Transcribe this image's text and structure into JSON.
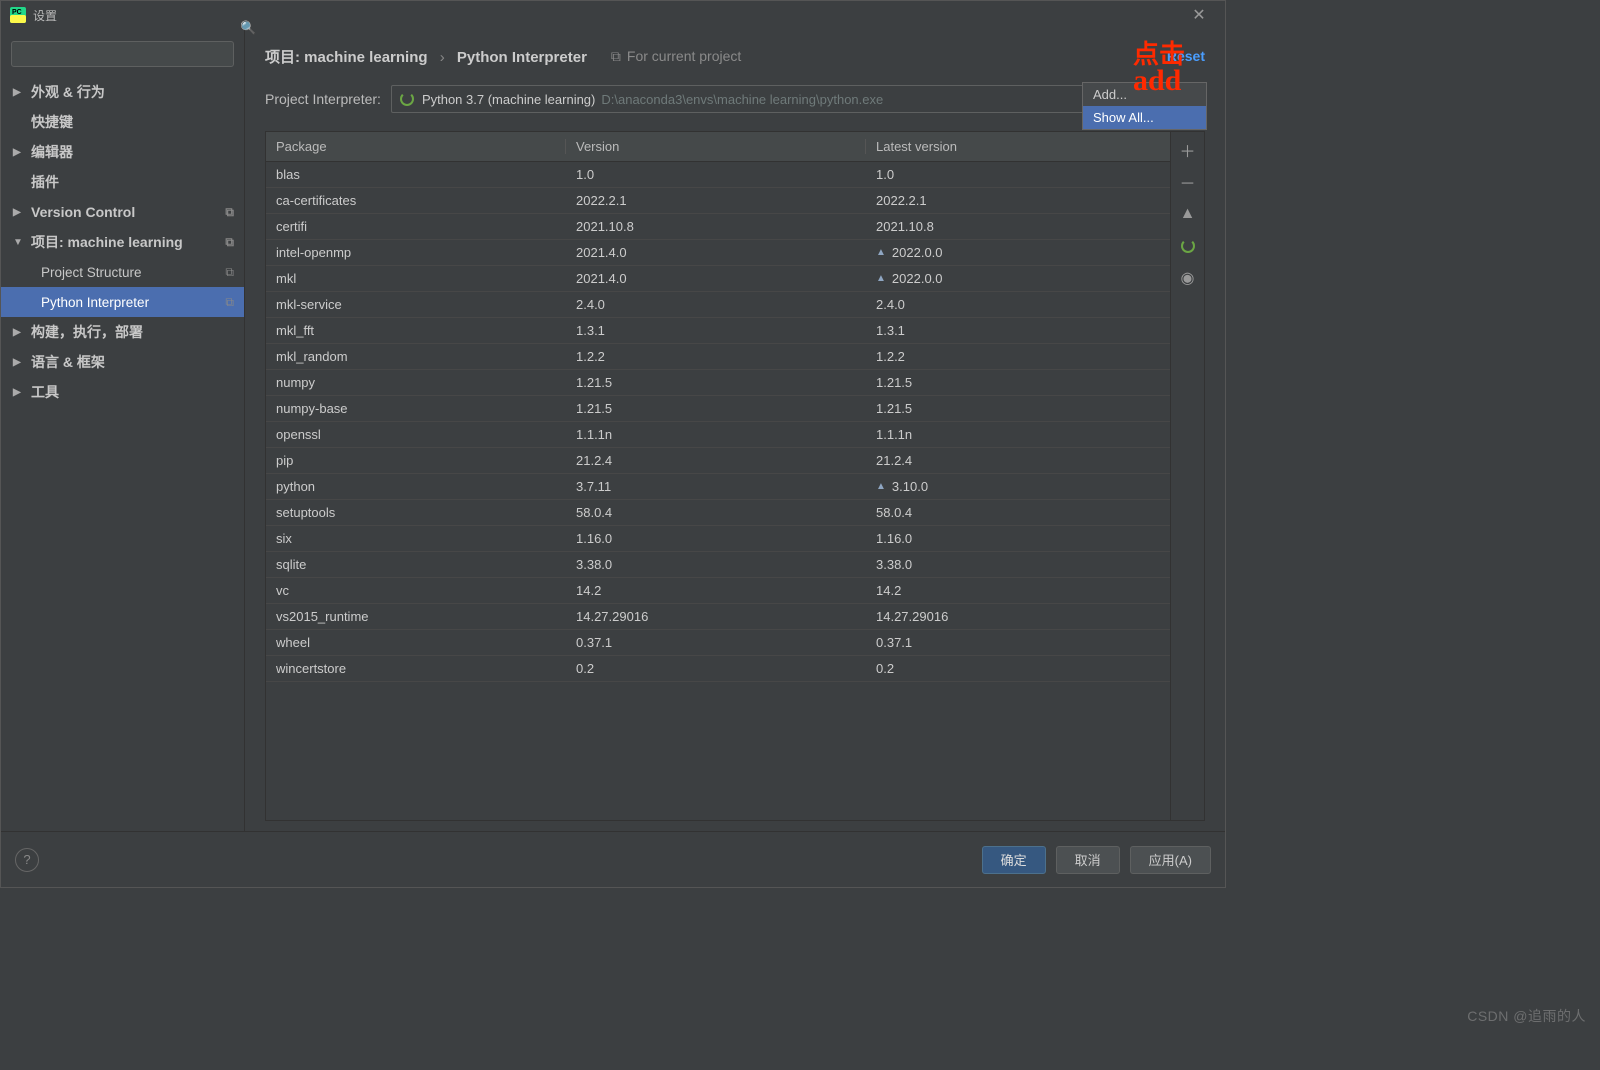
{
  "window": {
    "title": "设置"
  },
  "sidebar": {
    "search_placeholder": "",
    "items": [
      {
        "label": "外观 & 行为",
        "expandable": true,
        "level": 0
      },
      {
        "label": "快捷键",
        "expandable": false,
        "level": 0
      },
      {
        "label": "编辑器",
        "expandable": true,
        "level": 0
      },
      {
        "label": "插件",
        "expandable": false,
        "level": 0
      },
      {
        "label": "Version Control",
        "expandable": true,
        "level": 0,
        "copy": true
      },
      {
        "label": "项目: machine learning",
        "expandable": true,
        "expanded": true,
        "level": 0,
        "copy": true
      },
      {
        "label": "Project Structure",
        "level": 1,
        "copy": true
      },
      {
        "label": "Python Interpreter",
        "level": 1,
        "selected": true,
        "copy": true
      },
      {
        "label": "构建，执行，部署",
        "expandable": true,
        "level": 0
      },
      {
        "label": "语言 & 框架",
        "expandable": true,
        "level": 0
      },
      {
        "label": "工具",
        "expandable": true,
        "level": 0
      }
    ]
  },
  "header": {
    "breadcrumb1": "项目: machine learning",
    "breadcrumb2": "Python Interpreter",
    "for_current": "For current project",
    "reset": "Reset"
  },
  "interpreter": {
    "label": "Project Interpreter:",
    "name": "Python 3.7 (machine learning)",
    "path": "D:\\anaconda3\\envs\\machine learning\\python.exe"
  },
  "table": {
    "col_package": "Package",
    "col_version": "Version",
    "col_latest": "Latest version",
    "rows": [
      {
        "pkg": "blas",
        "ver": "1.0",
        "latest": "1.0"
      },
      {
        "pkg": "ca-certificates",
        "ver": "2022.2.1",
        "latest": "2022.2.1"
      },
      {
        "pkg": "certifi",
        "ver": "2021.10.8",
        "latest": "2021.10.8"
      },
      {
        "pkg": "intel-openmp",
        "ver": "2021.4.0",
        "latest": "2022.0.0",
        "upgrade": true
      },
      {
        "pkg": "mkl",
        "ver": "2021.4.0",
        "latest": "2022.0.0",
        "upgrade": true
      },
      {
        "pkg": "mkl-service",
        "ver": "2.4.0",
        "latest": "2.4.0"
      },
      {
        "pkg": "mkl_fft",
        "ver": "1.3.1",
        "latest": "1.3.1"
      },
      {
        "pkg": "mkl_random",
        "ver": "1.2.2",
        "latest": "1.2.2"
      },
      {
        "pkg": "numpy",
        "ver": "1.21.5",
        "latest": "1.21.5"
      },
      {
        "pkg": "numpy-base",
        "ver": "1.21.5",
        "latest": "1.21.5"
      },
      {
        "pkg": "openssl",
        "ver": "1.1.1n",
        "latest": "1.1.1n"
      },
      {
        "pkg": "pip",
        "ver": "21.2.4",
        "latest": "21.2.4"
      },
      {
        "pkg": "python",
        "ver": "3.7.11",
        "latest": "3.10.0",
        "upgrade": true
      },
      {
        "pkg": "setuptools",
        "ver": "58.0.4",
        "latest": "58.0.4"
      },
      {
        "pkg": "six",
        "ver": "1.16.0",
        "latest": "1.16.0"
      },
      {
        "pkg": "sqlite",
        "ver": "3.38.0",
        "latest": "3.38.0"
      },
      {
        "pkg": "vc",
        "ver": "14.2",
        "latest": "14.2"
      },
      {
        "pkg": "vs2015_runtime",
        "ver": "14.27.29016",
        "latest": "14.27.29016"
      },
      {
        "pkg": "wheel",
        "ver": "0.37.1",
        "latest": "0.37.1"
      },
      {
        "pkg": "wincertstore",
        "ver": "0.2",
        "latest": "0.2"
      }
    ]
  },
  "popup": {
    "add": "Add...",
    "showall": "Show All..."
  },
  "footer": {
    "ok": "确定",
    "cancel": "取消",
    "apply": "应用(A)"
  },
  "annotation": {
    "click": "点击",
    "add": "add"
  },
  "watermark": "CSDN @追雨的人"
}
